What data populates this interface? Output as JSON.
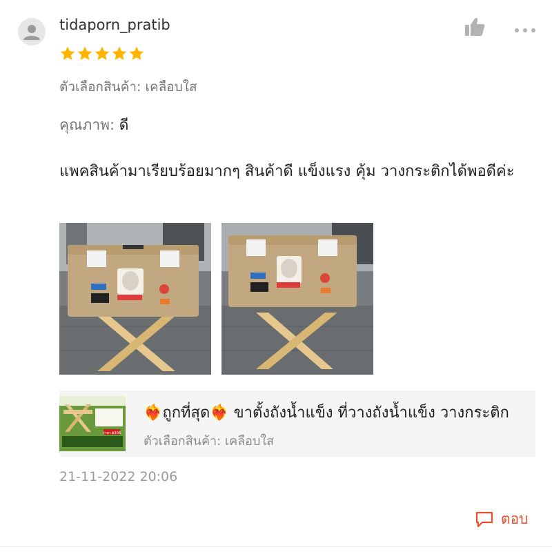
{
  "review": {
    "username": "tidaporn_pratib",
    "rating": 5,
    "rating_max": 5,
    "variant_label": "ตัวเลือกสินค้า: เคลือบใส",
    "quality_label": "คุณภาพ:",
    "quality_value": "ดี",
    "text": "แพคสินค้ามาเรียบร้อยมากๆ สินค้าดี แข็งแรง คุ้ม วางกระติกได้พอดีค่ะ",
    "timestamp": "21-11-2022 20:06",
    "reply_label": "ตอบ"
  },
  "product": {
    "title": "❤️‍🔥ถูกที่สุด❤️‍🔥 ขาตั้งถังน้ำแข็ง ที่วางถังน้ำแข็ง วางกระติก",
    "variant_label": "ตัวเลือกสินค้า: เคลือบใส",
    "thumb_price_text": "ราคา ฿308"
  },
  "icons": {
    "avatar": "user-icon",
    "like": "thumbs-up-icon",
    "more": "more-icon",
    "star": "star-icon",
    "reply": "chat-bubble-icon"
  },
  "colors": {
    "star": "#ffb400",
    "accent": "#ee4d2d",
    "secondary_text": "#777777",
    "card_bg": "#f5f5f5"
  }
}
